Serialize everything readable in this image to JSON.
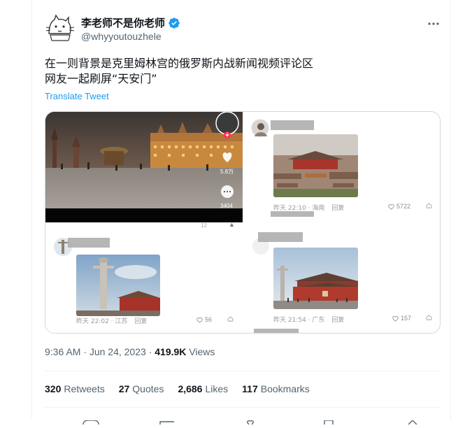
{
  "tweet": {
    "display_name": "李老师不是你老师",
    "handle": "@whyyoutouzhele",
    "text_line1": "在一则背景是克里姆林宫的俄罗斯内战新闻视频评论区",
    "text_line2": "网友一起刷屏“天安门”",
    "translate_label": "Translate Tweet",
    "time": "9:36 AM",
    "date": "Jun 24, 2023",
    "separator": "·",
    "views_count": "419.9K",
    "views_label": "Views"
  },
  "stats": {
    "retweets_count": "320",
    "retweets_label": "Retweets",
    "quotes_count": "27",
    "quotes_label": "Quotes",
    "likes_count": "2,686",
    "likes_label": "Likes",
    "bookmarks_count": "117",
    "bookmarks_label": "Bookmarks"
  },
  "media": {
    "video": {
      "likes": "5.8万",
      "comments": "3404",
      "bottom_count": "12"
    },
    "comment1": {
      "time": "昨天 22:10 · 海南",
      "reply": "回复",
      "likes": "5722"
    },
    "comment2": {
      "time": "昨天 22:02 · 江苏",
      "reply": "回复",
      "likes": "56"
    },
    "comment3": {
      "time": "昨天 21:54 · 广东",
      "reply": "回复",
      "likes": "157"
    }
  },
  "colors": {
    "link": "#1d9bf0",
    "verified": "#1d9bf0",
    "secondary": "#536471"
  }
}
